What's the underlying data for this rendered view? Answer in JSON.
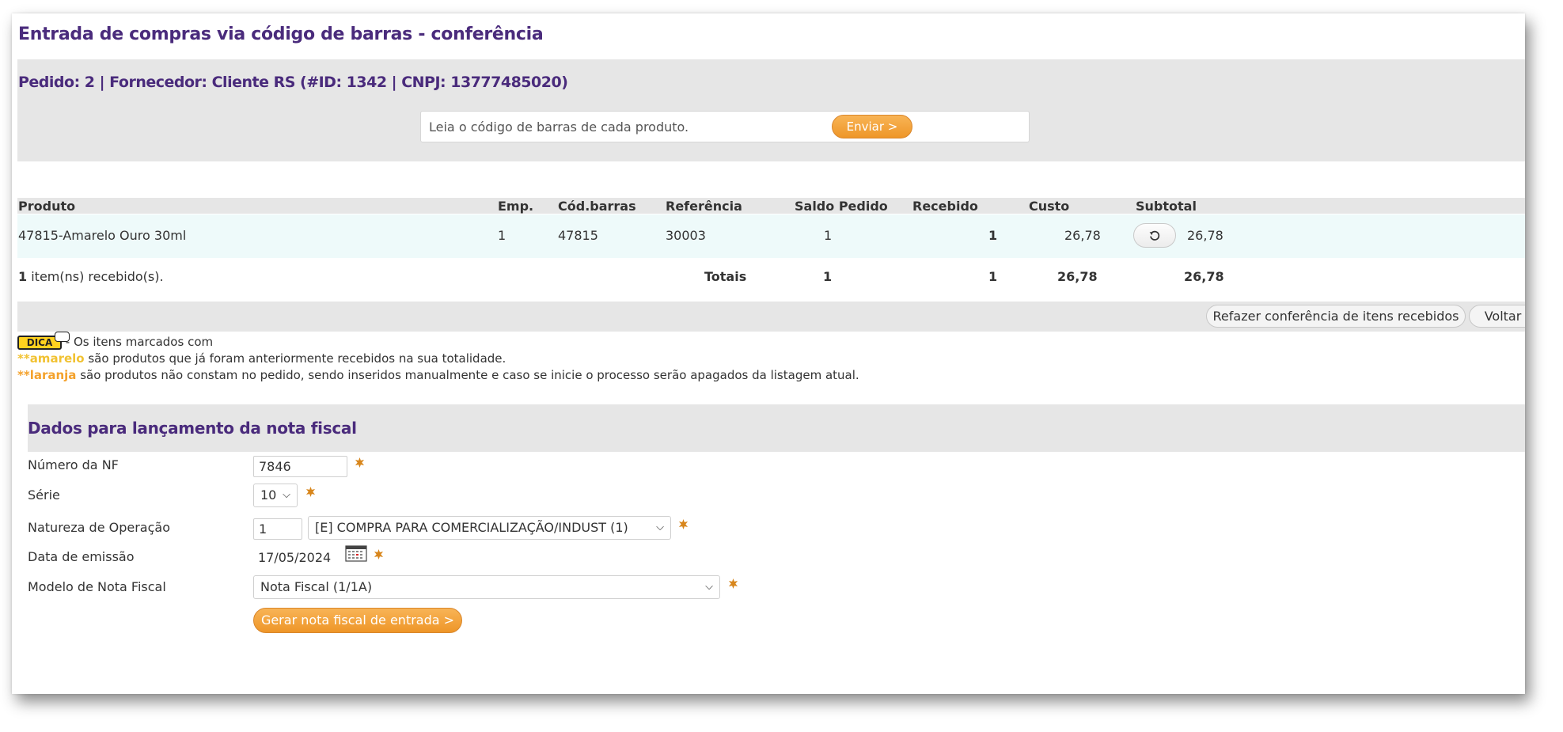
{
  "page": {
    "title": "Entrada de compras via código de barras - conferência"
  },
  "order": {
    "title": "Pedido: 2 | Fornecedor: Cliente RS (#ID: 1342 | CNPJ: 13777485020)",
    "barcode_placeholder": "Leia o código de barras de cada produto.",
    "send_label": "Enviar >"
  },
  "table": {
    "columns": [
      "Produto",
      "Emp.",
      "Cód.barras",
      "Referência",
      "Saldo Pedido",
      "Recebido",
      "Custo",
      "Subtotal"
    ],
    "rows": [
      {
        "produto": "47815-Amarelo Ouro 30ml",
        "emp": "1",
        "codbarras": "47815",
        "referencia": "30003",
        "saldo_pedido": "1",
        "recebido": "1",
        "custo": "26,78",
        "subtotal": "26,78"
      }
    ],
    "received_count": "1",
    "received_text": " item(ns) recebido(s).",
    "totals": {
      "label": "Totais",
      "saldo_pedido": "1",
      "recebido": "1",
      "custo": "26,78",
      "subtotal": "26,78"
    }
  },
  "actions": {
    "redo_label": "Refazer conferência de itens recebidos",
    "back_label": "Voltar"
  },
  "tip": {
    "badge": "DICA",
    "intro": " - Os itens marcados com",
    "amarelo_mark": "**amarelo",
    "amarelo_text": " são produtos que já foram anteriormente recebidos na sua totalidade.",
    "laranja_mark": "**laranja",
    "laranja_text": " são produtos não constam no pedido, sendo inseridos manualmente e caso se inicie o processo serão apagados da listagem atual.",
    "colors": {
      "amarelo": "#f1c232",
      "laranja": "#f4a22c"
    }
  },
  "invoice": {
    "title": "Dados para lançamento da nota fiscal",
    "numero_label": "Número da NF",
    "numero_value": "7846",
    "serie_label": "Série",
    "serie_value": "10",
    "natureza_label": "Natureza de Operação",
    "natureza_code": "1",
    "natureza_value": "[E] COMPRA PARA COMERCIALIZAÇÃO/INDUST (1)",
    "data_label": "Data de emissão",
    "data_value": "17/05/2024",
    "modelo_label": "Modelo de Nota Fiscal",
    "modelo_value": "Nota Fiscal (1/1A)",
    "generate_label": "Gerar nota fiscal de entrada >",
    "required_icon": "required-asterisk-icon",
    "calendar_icon": "calendar-icon"
  },
  "colors": {
    "title_purple": "#4a2b7c",
    "accent_orange": "#f0a030",
    "panel_gray": "#e6e6e6",
    "row_highlight": "#eefafa"
  }
}
